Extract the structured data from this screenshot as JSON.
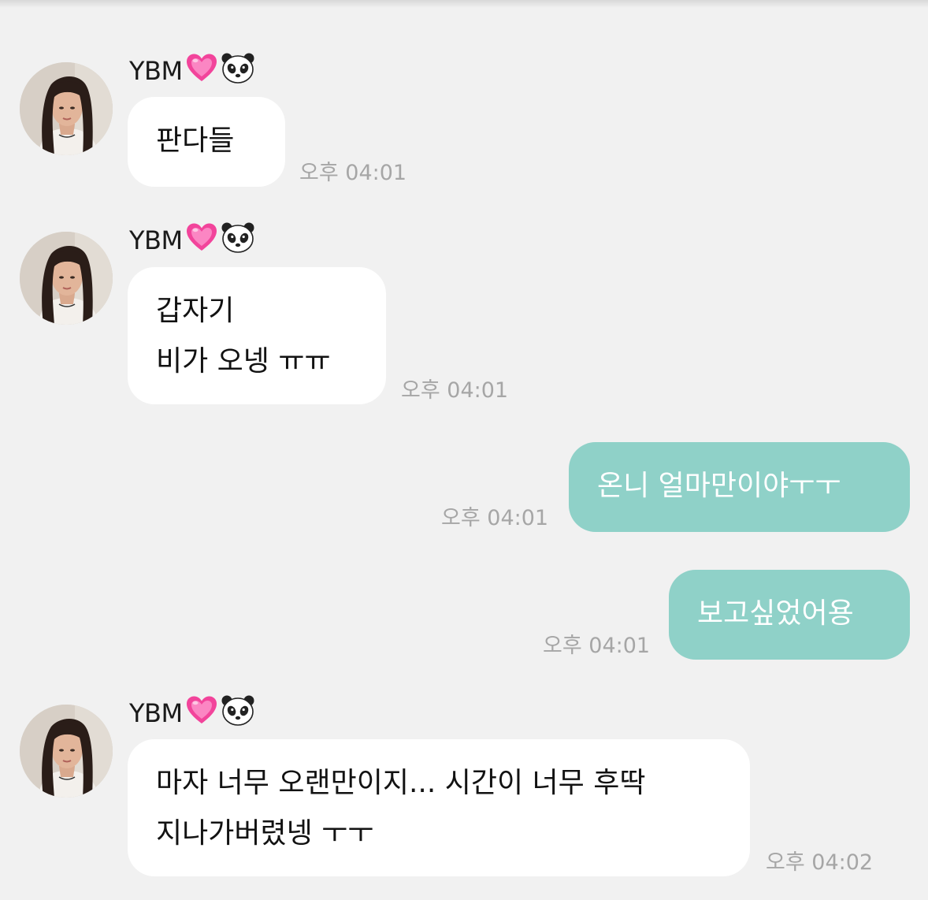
{
  "messages": [
    {
      "sender": "YBM",
      "direction": "incoming",
      "lines": [
        "판다들"
      ],
      "time": "오후 04:01"
    },
    {
      "sender": "YBM",
      "direction": "incoming",
      "lines": [
        "갑자기",
        "비가 오넹 ㅠㅠ"
      ],
      "time": "오후 04:01"
    },
    {
      "direction": "outgoing",
      "lines": [
        "온니 얼마만이야ㅜㅜ"
      ],
      "time": "오후 04:01"
    },
    {
      "direction": "outgoing",
      "lines": [
        "보고싶었어용"
      ],
      "time": "오후 04:01"
    },
    {
      "sender": "YBM",
      "direction": "incoming",
      "lines": [
        "마자 너무 오랜만이지... 시간이 너무 후딱",
        "지나가버렸넹 ㅜㅜ"
      ],
      "time": "오후 04:02"
    }
  ],
  "sender_emojis": [
    "heart-icon",
    "panda-icon"
  ],
  "colors": {
    "background": "#f1f1f1",
    "incoming_bubble": "#ffffff",
    "outgoing_bubble": "#8fd1c8",
    "timestamp": "#a6a6a6",
    "heart": "#f2449b"
  }
}
